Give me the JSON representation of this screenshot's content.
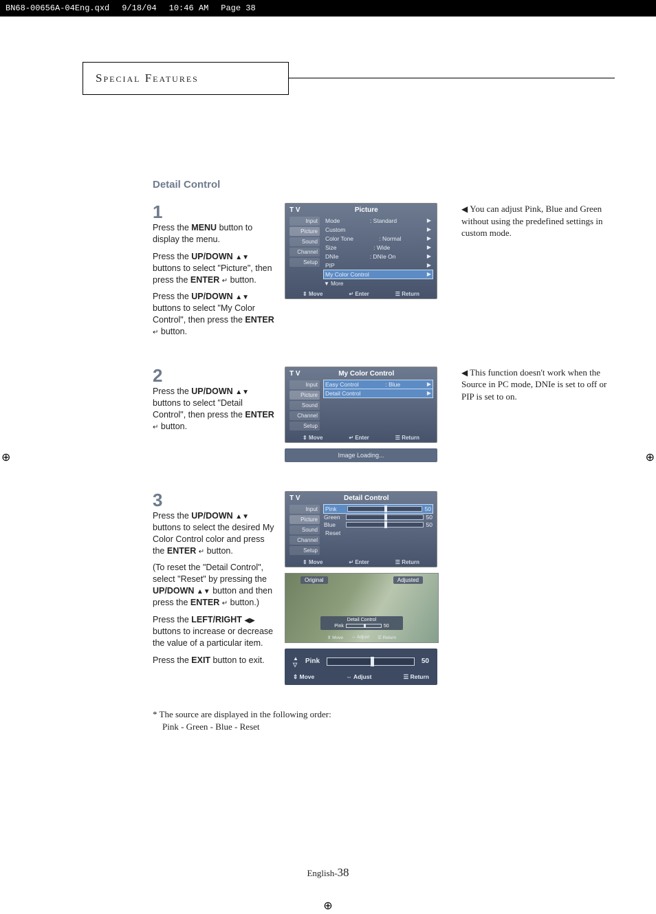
{
  "header_strip": {
    "file": "BN68-00656A-04Eng.qxd",
    "date": "9/18/04",
    "time": "10:46 AM",
    "page_label": "Page 38"
  },
  "section_header": "Special Features",
  "section_subtitle": "Detail Control",
  "steps": {
    "s1": {
      "num": "1",
      "p1a": "Press the ",
      "p1b": "MENU",
      "p1c": " button to display the menu.",
      "p2a": "Press the ",
      "p2b": "UP/DOWN",
      "p2c": " buttons to select \"Picture\", then press the ",
      "p2d": "ENTER",
      "p2e": " button.",
      "p3a": "Press the ",
      "p3b": "UP/DOWN",
      "p3c": " buttons to select \"My Color Control\", then press the ",
      "p3d": "ENTER",
      "p3e": " button.",
      "note": "You can adjust Pink, Blue and Green without using the predefined settings in custom mode."
    },
    "s2": {
      "num": "2",
      "p1a": "Press the ",
      "p1b": "UP/DOWN",
      "p1c": " buttons to select \"Detail Control\", then press the ",
      "p1d": "ENTER",
      "p1e": " button.",
      "note": "This function doesn't work when the Source in PC mode, DNIe is set to off or PIP is set to on."
    },
    "s3": {
      "num": "3",
      "p1a": "Press the ",
      "p1b": "UP/DOWN",
      "p1c": " buttons to select the desired My Color Control color and press the ",
      "p1d": "ENTER",
      "p1e": " button.",
      "p2a": "(To reset the \"Detail Control\", select \"Reset\" by pressing the ",
      "p2b": "UP/DOWN",
      "p2c": " button and then press the ",
      "p2d": "ENTER",
      "p2e": " button.)",
      "p3a": "Press the ",
      "p3b": "LEFT/RIGHT",
      "p3c": " buttons to increase or decrease the value of a particular item.",
      "p4a": "Press the ",
      "p4b": "EXIT",
      "p4c": " button to exit."
    }
  },
  "osd1": {
    "tv": "T V",
    "title": "Picture",
    "nav": [
      "Input",
      "Picture",
      "Sound",
      "Channel",
      "Setup"
    ],
    "rows": [
      {
        "l": "Mode",
        "r": ": Standard"
      },
      {
        "l": "Custom",
        "r": ""
      },
      {
        "l": "Color Tone",
        "r": ": Normal"
      },
      {
        "l": "Size",
        "r": ": Wide"
      },
      {
        "l": "DNIe",
        "r": ": DNIe On"
      },
      {
        "l": "PIP",
        "r": ""
      },
      {
        "l": "My Color Control",
        "r": ""
      }
    ],
    "more": "▼ More",
    "foot": {
      "move": "Move",
      "enter": "Enter",
      "return": "Return"
    }
  },
  "osd2": {
    "tv": "T V",
    "title": "My Color Control",
    "nav": [
      "Input",
      "Picture",
      "Sound",
      "Channel",
      "Setup"
    ],
    "rows": [
      {
        "l": "Easy Control",
        "r": ": Blue"
      },
      {
        "l": "Detail Control",
        "r": ""
      }
    ],
    "foot": {
      "move": "Move",
      "enter": "Enter",
      "return": "Return"
    }
  },
  "loading": "Image Loading...",
  "osd3": {
    "tv": "T V",
    "title": "Detail Control",
    "nav": [
      "Input",
      "Picture",
      "Sound",
      "Channel",
      "Setup"
    ],
    "sliders": [
      {
        "name": "Pink",
        "val": "50"
      },
      {
        "name": "Green",
        "val": "50"
      },
      {
        "name": "Blue",
        "val": "50"
      },
      {
        "name": "Reset",
        "val": ""
      }
    ],
    "foot": {
      "move": "Move",
      "enter": "Enter",
      "return": "Return"
    }
  },
  "compare": {
    "orig": "Original",
    "adj": "Adjusted",
    "badge_title": "Detail Control",
    "mini_label": "Pink",
    "mini_val": "50",
    "foot": {
      "move": "Move",
      "adjust": "Adjust",
      "return": "Return"
    }
  },
  "pinkslider": {
    "label": "Pink",
    "val": "50",
    "foot": {
      "move": "Move",
      "adjust": "Adjust",
      "return": "Return"
    }
  },
  "footnote": {
    "l1": "* The source are displayed in the following order:",
    "l2": "Pink - Green - Blue - Reset"
  },
  "page_footer": {
    "lang": "English-",
    "num": "38"
  },
  "glyphs": {
    "updown": "▲▼",
    "leftright": "◀▶",
    "enter": "↵",
    "move_ud": "⇕",
    "move_lr": "⇔",
    "enter_sym": "↵",
    "return_sym": "☰"
  }
}
